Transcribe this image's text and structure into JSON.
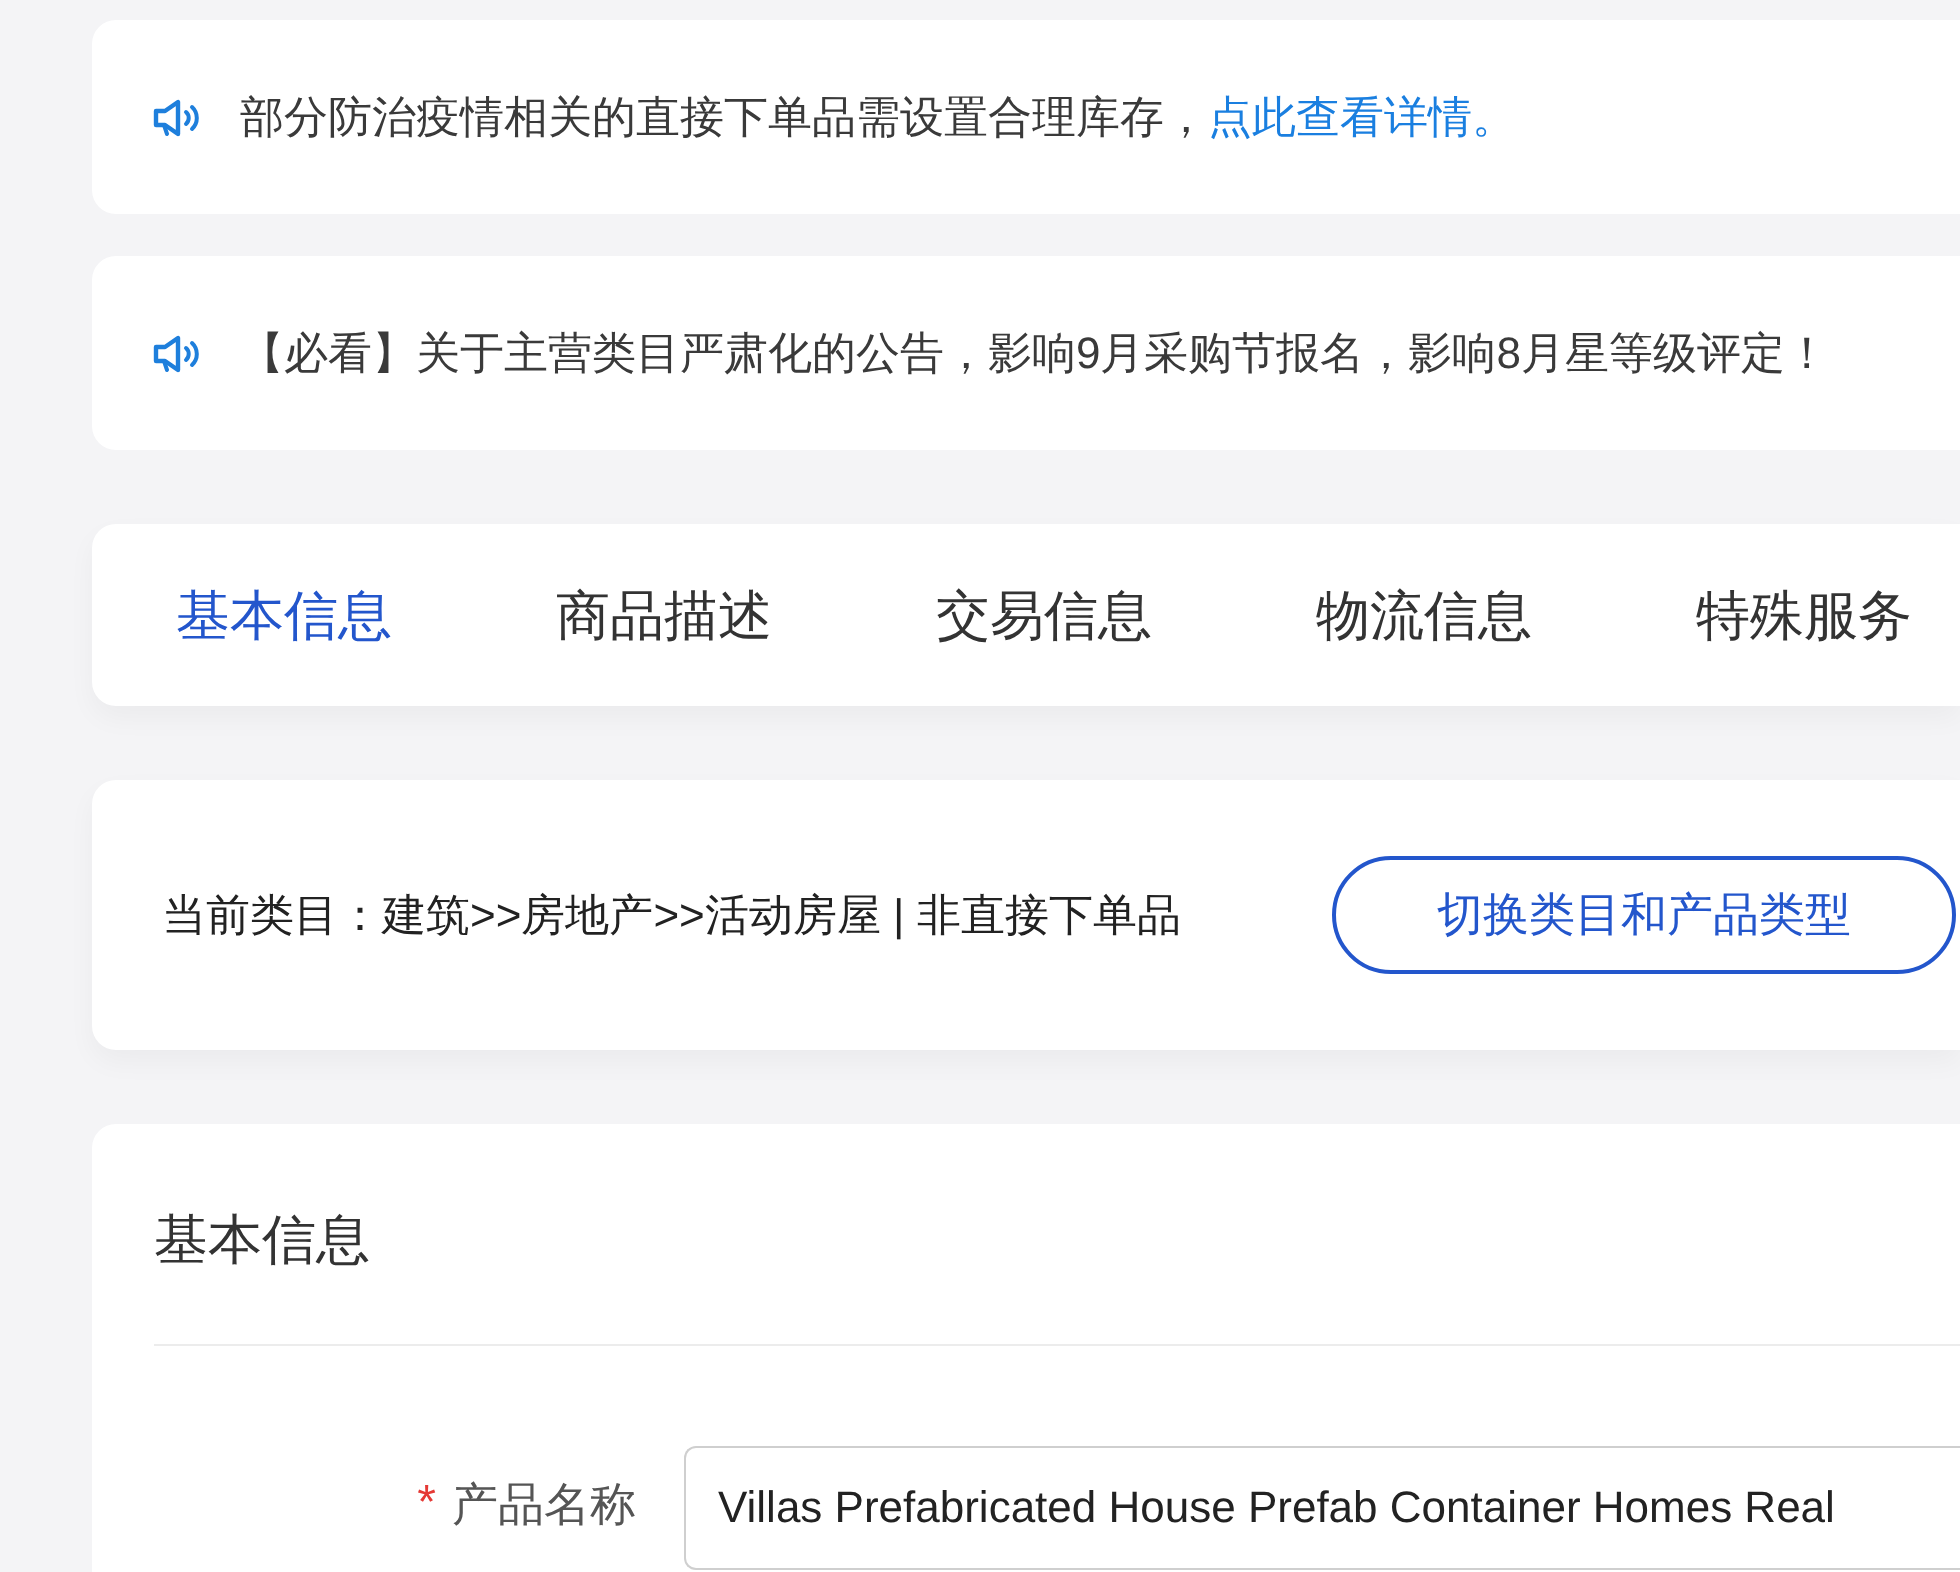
{
  "notices": [
    {
      "text": "部分防治疫情相关的直接下单品需设置合理库存，",
      "link": "点此查看详情。"
    },
    {
      "text": "【必看】关于主营类目严肃化的公告，影响9月采购节报名，影响8月星等级评定！"
    }
  ],
  "tabs": [
    {
      "label": "基本信息",
      "selected": true
    },
    {
      "label": "商品描述",
      "selected": false
    },
    {
      "label": "交易信息",
      "selected": false
    },
    {
      "label": "物流信息",
      "selected": false
    },
    {
      "label": "特殊服务",
      "selected": false
    }
  ],
  "category": {
    "text": "当前类目：建筑>>房地产>>活动房屋 | 非直接下单品",
    "button": "切换类目和产品类型"
  },
  "basic_info": {
    "title": "基本信息",
    "fields": [
      {
        "required_mark": "*",
        "label": "产品名称",
        "value": "Villas Prefabricated House Prefab Container Homes Real"
      }
    ]
  }
}
